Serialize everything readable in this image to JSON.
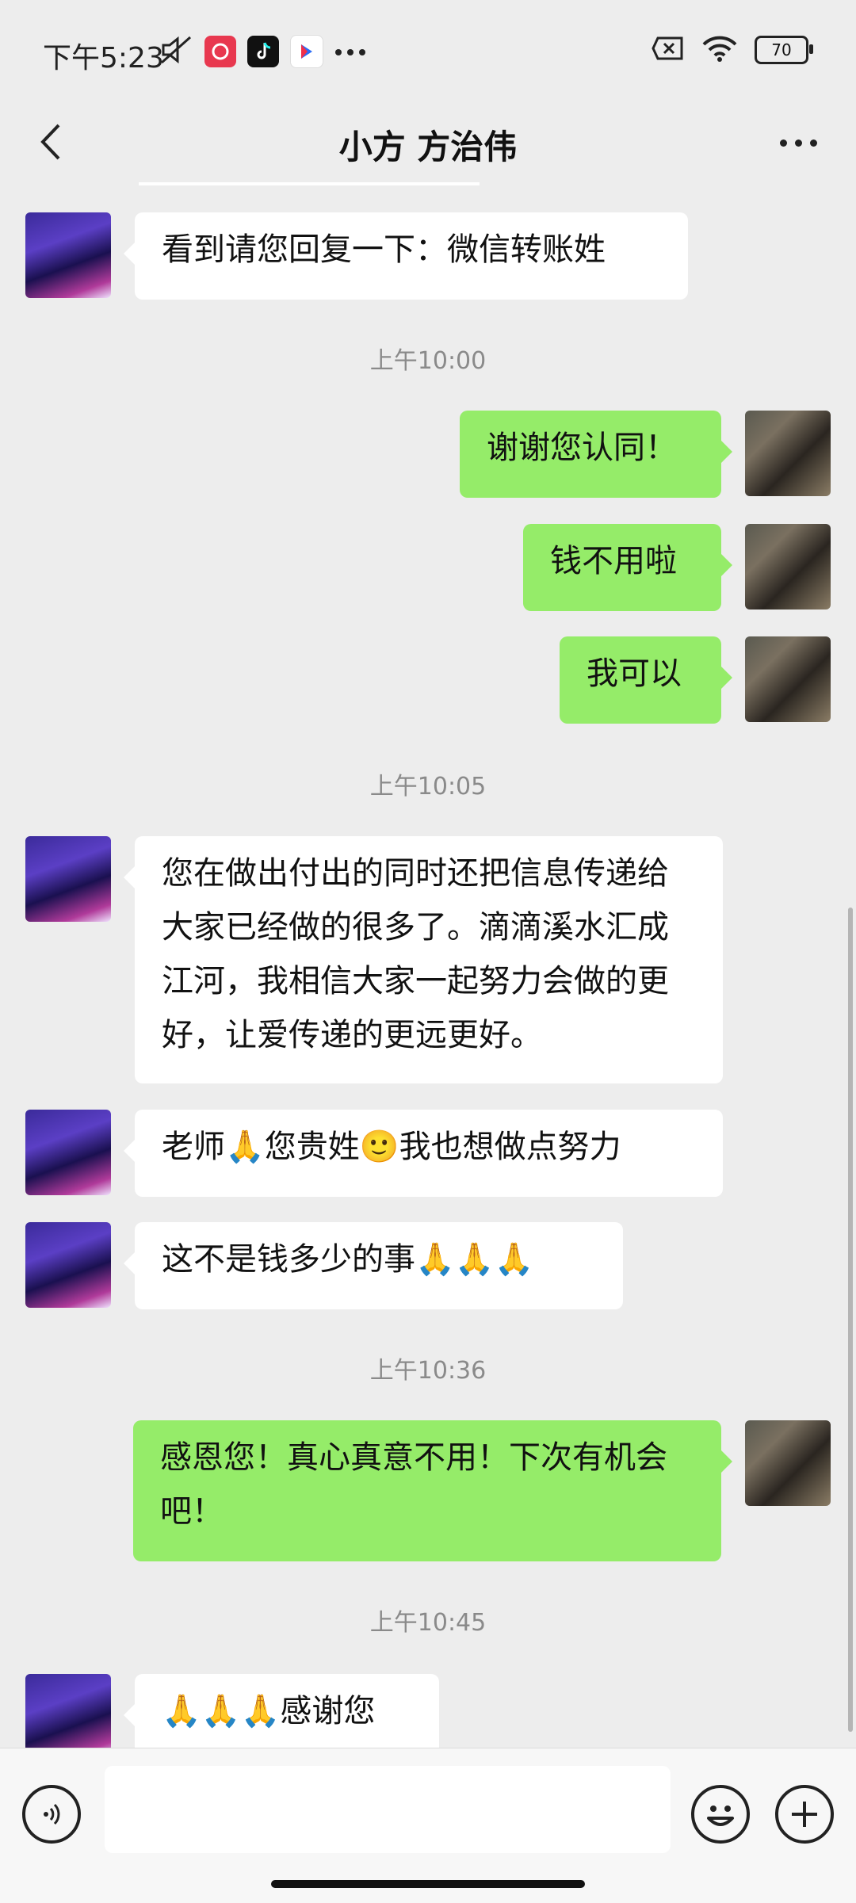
{
  "status_bar": {
    "time": "下午5:23",
    "battery": "70",
    "icons": [
      "mute-icon",
      "shopping-618-icon",
      "tiktok-icon",
      "video-app-icon",
      "more-dots-icon",
      "no-sim-icon",
      "wifi-icon",
      "battery-icon"
    ]
  },
  "header": {
    "title": "小方 方治伟",
    "back_icon": "back-arrow-icon",
    "more_icon": "more-icon"
  },
  "messages": [
    {
      "type": "in",
      "text": "看到请您回复一下：微信转账姓"
    },
    {
      "type": "time",
      "text": "上午10:00"
    },
    {
      "type": "out",
      "text": "谢谢您认同！"
    },
    {
      "type": "out",
      "text": "钱不用啦"
    },
    {
      "type": "out",
      "text": "我可以"
    },
    {
      "type": "time",
      "text": "上午10:05"
    },
    {
      "type": "in",
      "text": "您在做出付出的同时还把信息传递给大家已经做的很多了。滴滴溪水汇成江河，我相信大家一起努力会做的更好，让爱传递的更远更好。"
    },
    {
      "type": "in",
      "text": "老师🙏您贵姓🙂我也想做点努力"
    },
    {
      "type": "in",
      "text": "这不是钱多少的事🙏🙏🙏"
    },
    {
      "type": "time",
      "text": "上午10:36"
    },
    {
      "type": "out",
      "text": "感恩您！真心真意不用！下次有机会吧！"
    },
    {
      "type": "time",
      "text": "上午10:45"
    },
    {
      "type": "in",
      "text": "🙏🙏🙏感谢您"
    }
  ],
  "input_bar": {
    "placeholder": "",
    "icons": [
      "voice-icon",
      "emoji-icon",
      "plus-icon"
    ]
  },
  "colors": {
    "outgoing_bubble": "#95ec69",
    "incoming_bubble": "#ffffff",
    "background": "#ededed"
  }
}
